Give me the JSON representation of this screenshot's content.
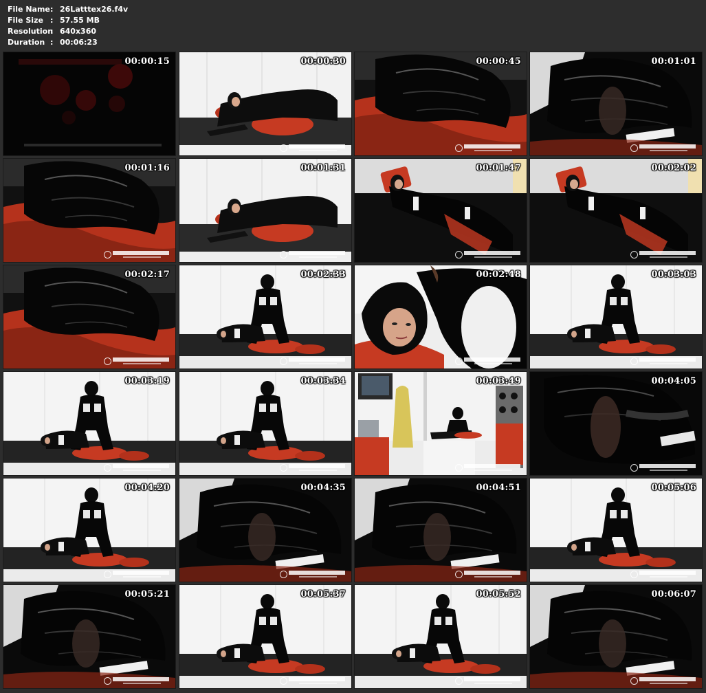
{
  "file_info": {
    "rows": [
      {
        "label": "File Name",
        "value": "26Latttex26.f4v"
      },
      {
        "label": "File Size",
        "value": "57.55 MB"
      },
      {
        "label": "Resolution",
        "value": "640x360"
      },
      {
        "label": "Duration",
        "value": "00:06:23"
      }
    ]
  },
  "colors": {
    "background": "#2d2d2d",
    "stamp_text": "#ffffff",
    "accent_red": "#c63a22"
  },
  "thumbnails": [
    {
      "time": "00:00:15",
      "scene": "dark-intro"
    },
    {
      "time": "00:00:30",
      "scene": "white-room-lying"
    },
    {
      "time": "00:00:45",
      "scene": "latex-closeup-red"
    },
    {
      "time": "00:01:01",
      "scene": "latex-closeup-white"
    },
    {
      "time": "00:01:16",
      "scene": "latex-closeup-red"
    },
    {
      "time": "00:01:31",
      "scene": "white-room-lying"
    },
    {
      "time": "00:01:47",
      "scene": "dark-room-lying"
    },
    {
      "time": "00:02:02",
      "scene": "dark-room-lying"
    },
    {
      "time": "00:02:17",
      "scene": "latex-closeup-red"
    },
    {
      "time": "00:02:33",
      "scene": "white-room-two"
    },
    {
      "time": "00:02:48",
      "scene": "face-closeup"
    },
    {
      "time": "00:03:03",
      "scene": "white-room-two"
    },
    {
      "time": "00:03:19",
      "scene": "white-room-two"
    },
    {
      "time": "00:03:34",
      "scene": "white-room-two"
    },
    {
      "time": "00:03:49",
      "scene": "clinic-room"
    },
    {
      "time": "00:04:05",
      "scene": "latex-closeup-dark"
    },
    {
      "time": "00:04:20",
      "scene": "white-room-two"
    },
    {
      "time": "00:04:35",
      "scene": "latex-closeup-white"
    },
    {
      "time": "00:04:51",
      "scene": "latex-closeup-white"
    },
    {
      "time": "00:05:06",
      "scene": "white-room-two"
    },
    {
      "time": "00:05:21",
      "scene": "latex-closeup-white"
    },
    {
      "time": "00:05:37",
      "scene": "white-room-two"
    },
    {
      "time": "00:05:52",
      "scene": "white-room-two"
    },
    {
      "time": "00:06:07",
      "scene": "latex-closeup-white"
    }
  ]
}
